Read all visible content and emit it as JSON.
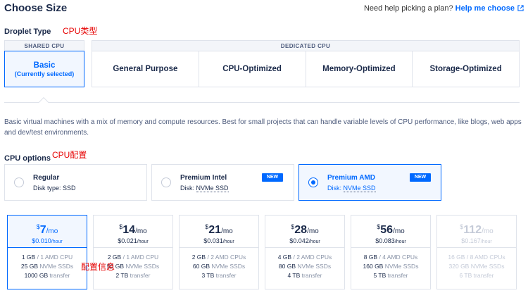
{
  "header": {
    "title": "Choose Size",
    "help_text": "Need help picking a plan?",
    "help_link": "Help me choose"
  },
  "droplet_type": {
    "label": "Droplet Type",
    "annotation": "CPU类型",
    "shared_header": "SHARED CPU",
    "dedicated_header": "DEDICATED CPU",
    "basic": {
      "title": "Basic",
      "subtitle": "(Currently selected)"
    },
    "dedicated_tabs": [
      "General Purpose",
      "CPU-Optimized",
      "Memory-Optimized",
      "Storage-Optimized"
    ]
  },
  "description": "Basic virtual machines with a mix of memory and compute resources. Best for small projects that can handle variable levels of CPU performance, like blogs, web apps and dev/test environments.",
  "cpu_options": {
    "label": "CPU options",
    "annotation": "CPU配置",
    "items": [
      {
        "name": "Regular",
        "disk_prefix": "Disk type: ",
        "disk_value": "SSD",
        "badge": "",
        "selected": false
      },
      {
        "name": "Premium Intel",
        "disk_prefix": "Disk: ",
        "disk_value": "NVMe SSD",
        "badge": "NEW",
        "selected": false
      },
      {
        "name": "Premium AMD",
        "disk_prefix": "Disk: ",
        "disk_value": "NVMe SSD",
        "badge": "NEW",
        "selected": true
      }
    ]
  },
  "plans_annotation": "配置信息",
  "plans": [
    {
      "currency": "$",
      "price": "7",
      "per": "/mo",
      "hourly": "$0.010",
      "hourly_unit": "/hour",
      "mem": "1 GB",
      "cpu": "/ 1 AMD CPU",
      "disk": "25 GB",
      "disk_type": "NVMe SSDs",
      "transfer": "1000 GB",
      "transfer_label": "transfer",
      "selected": true,
      "disabled": false
    },
    {
      "currency": "$",
      "price": "14",
      "per": "/mo",
      "hourly": "$0.021",
      "hourly_unit": "/hour",
      "mem": "2 GB",
      "cpu": "/ 1 AMD CPU",
      "disk": "50 GB",
      "disk_type": "NVMe SSDs",
      "transfer": "2 TB",
      "transfer_label": "transfer",
      "selected": false,
      "disabled": false
    },
    {
      "currency": "$",
      "price": "21",
      "per": "/mo",
      "hourly": "$0.031",
      "hourly_unit": "/hour",
      "mem": "2 GB",
      "cpu": "/ 2 AMD CPUs",
      "disk": "60 GB",
      "disk_type": "NVMe SSDs",
      "transfer": "3 TB",
      "transfer_label": "transfer",
      "selected": false,
      "disabled": false
    },
    {
      "currency": "$",
      "price": "28",
      "per": "/mo",
      "hourly": "$0.042",
      "hourly_unit": "/hour",
      "mem": "4 GB",
      "cpu": "/ 2 AMD CPUs",
      "disk": "80 GB",
      "disk_type": "NVMe SSDs",
      "transfer": "4 TB",
      "transfer_label": "transfer",
      "selected": false,
      "disabled": false
    },
    {
      "currency": "$",
      "price": "56",
      "per": "/mo",
      "hourly": "$0.083",
      "hourly_unit": "/hour",
      "mem": "8 GB",
      "cpu": "/ 4 AMD CPUs",
      "disk": "160 GB",
      "disk_type": "NVMe SSDs",
      "transfer": "5 TB",
      "transfer_label": "transfer",
      "selected": false,
      "disabled": false
    },
    {
      "currency": "$",
      "price": "112",
      "per": "/mo",
      "hourly": "$0.167",
      "hourly_unit": "/hour",
      "mem": "16 GB",
      "cpu": "/ 8 AMD CPUs",
      "disk": "320 GB",
      "disk_type": "NVMe SSDs",
      "transfer": "6 TB",
      "transfer_label": "transfer",
      "selected": false,
      "disabled": true
    }
  ],
  "colors": {
    "accent": "#0069ff",
    "annotation": "#e60000",
    "border": "#dfe3eb"
  }
}
